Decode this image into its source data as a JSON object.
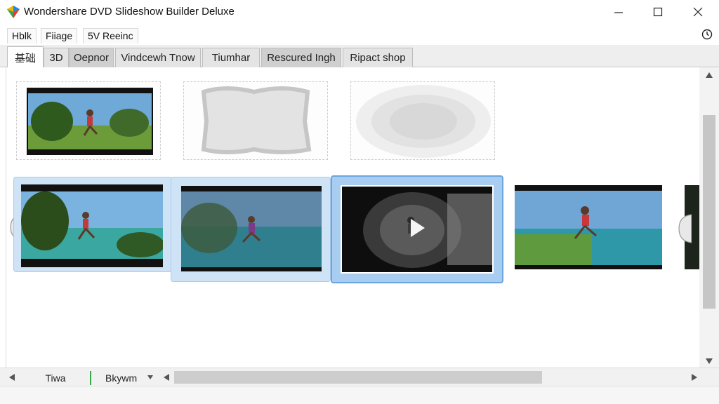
{
  "window": {
    "title": "Wondershare DVD Slideshow Builder Deluxe"
  },
  "menu": {
    "items": [
      "Hblk",
      "Fiiage",
      "5V Reeinc"
    ]
  },
  "tabs": [
    {
      "label": "基础"
    },
    {
      "label": "3D"
    },
    {
      "label": "Oepnor"
    },
    {
      "label": "Vindcewh Tnow"
    },
    {
      "label": "Tiumhar"
    },
    {
      "label": "Rescured Ingh"
    },
    {
      "label": "Ripact shop"
    }
  ],
  "bottom": {
    "left_button": "Tiwa",
    "dropdown": "Bkywm"
  },
  "colors": {
    "accent_blue": "#6aa6e0",
    "selected_light": "#cfe3f6"
  },
  "icons": {
    "app": "wondershare-logo-icon",
    "help": "clock-icon"
  }
}
